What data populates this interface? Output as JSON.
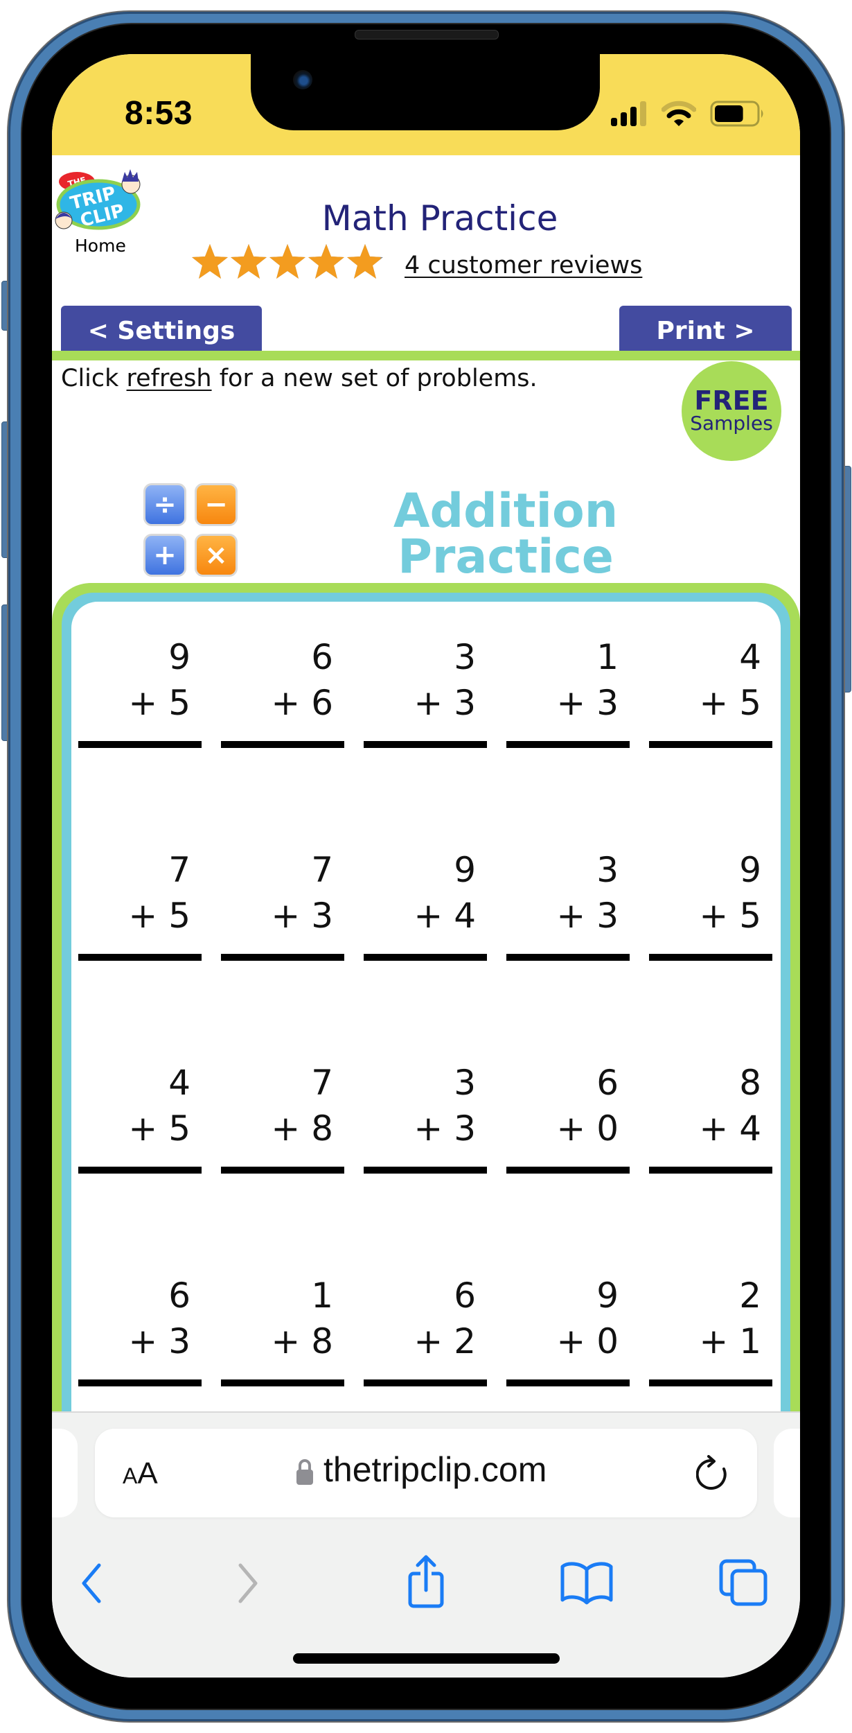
{
  "status_bar": {
    "time": "8:53",
    "signal_bars": 3,
    "signal_bars_max": 4,
    "wifi_strength": 2,
    "wifi_strength_max": 3,
    "battery_percent": 70
  },
  "header": {
    "logo": {
      "line1": "THE",
      "line2": "TRIP",
      "line3": "CLIP",
      "registered": "®"
    },
    "home_label": "Home",
    "title": "Math Practice",
    "rating": 4.9,
    "rating_max": 5,
    "reviews_link": "4 customer reviews"
  },
  "nav": {
    "settings_label": "< Settings",
    "print_label": "Print >"
  },
  "instruction": {
    "prefix": "Click ",
    "link": "refresh",
    "suffix": " for a new set of problems."
  },
  "free_badge": {
    "line1": "FREE",
    "line2": "Samples"
  },
  "section": {
    "icon_keys": [
      "÷",
      "−",
      "+",
      "×"
    ],
    "title_line1": "Addition",
    "title_line2": "Practice"
  },
  "worksheet": {
    "operator": "+",
    "problems": [
      [
        {
          "a": "9",
          "b": "5"
        },
        {
          "a": "6",
          "b": "6"
        },
        {
          "a": "3",
          "b": "3"
        },
        {
          "a": "1",
          "b": "3"
        },
        {
          "a": "4",
          "b": "5"
        }
      ],
      [
        {
          "a": "7",
          "b": "5"
        },
        {
          "a": "7",
          "b": "3"
        },
        {
          "a": "9",
          "b": "4"
        },
        {
          "a": "3",
          "b": "3"
        },
        {
          "a": "9",
          "b": "5"
        }
      ],
      [
        {
          "a": "4",
          "b": "5"
        },
        {
          "a": "7",
          "b": "8"
        },
        {
          "a": "3",
          "b": "3"
        },
        {
          "a": "6",
          "b": "0"
        },
        {
          "a": "8",
          "b": "4"
        }
      ],
      [
        {
          "a": "6",
          "b": "3"
        },
        {
          "a": "1",
          "b": "8"
        },
        {
          "a": "6",
          "b": "2"
        },
        {
          "a": "9",
          "b": "0"
        },
        {
          "a": "2",
          "b": "1"
        }
      ]
    ]
  },
  "browser": {
    "text_size_label_small": "A",
    "text_size_label_large": "A",
    "url": "thetripclip.com",
    "toolbar": [
      "back-icon",
      "forward-icon",
      "share-icon",
      "bookmarks-icon",
      "tabs-icon"
    ],
    "forward_enabled": false
  },
  "colors": {
    "status_bar_bg": "#f8dc58",
    "title_navy": "#232378",
    "button_bg": "#434ba0",
    "accent_green": "#a8dc58",
    "accent_cyan": "#73ccdc",
    "star_orange": "#f39c1f",
    "ios_blue": "#1a7cf5"
  }
}
